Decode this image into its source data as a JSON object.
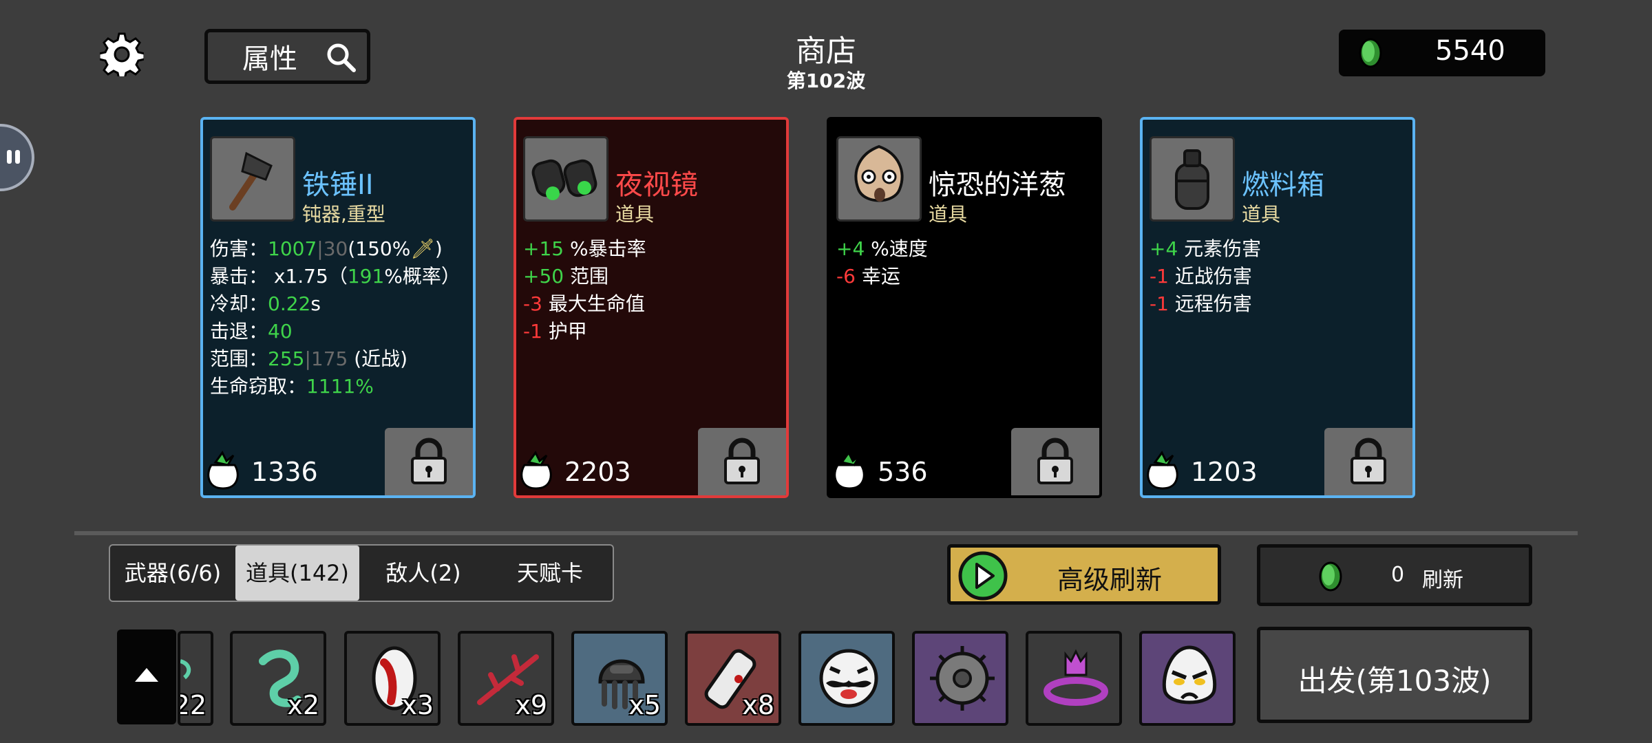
{
  "header": {
    "title": "商店",
    "wave": "第102波",
    "search_label": "属性",
    "money": "5540"
  },
  "cards": [
    {
      "name": "铁锤II",
      "type": "钝器,重型",
      "name_color": "#6cc3ff",
      "icon": "hammer-icon",
      "stats": {
        "damage_label": "伤害：",
        "damage_val": "1007",
        "damage_sep": "|30",
        "damage_pct": "(150%",
        "damage_end": ")",
        "crit_label": "暴击： x1.75（",
        "crit_val": "191",
        "crit_end": "%概率）",
        "cd_label": "冷却：",
        "cd_val": "0.22",
        "cd_unit": "s",
        "kb_label": "击退：",
        "kb_val": "40",
        "range_label": "范围：",
        "range_val": "255",
        "range_sep": "|175",
        "range_end": " (近战)",
        "ls_label": "生命窃取：",
        "ls_val": "1111%"
      },
      "price": "1336"
    },
    {
      "name": "夜视镜",
      "type": "道具",
      "name_color": "#ff4a4a",
      "icon": "binoculars-icon",
      "stats": [
        {
          "val": "+15",
          "text": " %暴击率",
          "color": "g"
        },
        {
          "val": "+50",
          "text": " 范围",
          "color": "g"
        },
        {
          "val": "-3",
          "text": " 最大生命值",
          "color": "r"
        },
        {
          "val": "-1",
          "text": " 护甲",
          "color": "r"
        }
      ],
      "price": "2203"
    },
    {
      "name": "惊恐的洋葱",
      "type": "道具",
      "name_color": "#ffffff",
      "icon": "onion-face-icon",
      "stats": [
        {
          "val": "+4",
          "text": " %速度",
          "color": "g"
        },
        {
          "val": "-6",
          "text": " 幸运",
          "color": "r"
        }
      ],
      "price": "536"
    },
    {
      "name": "燃料箱",
      "type": "道具",
      "name_color": "#6cc3ff",
      "icon": "fuel-tank-icon",
      "stats": [
        {
          "val": "+4",
          "text": " 元素伤害",
          "color": "g"
        },
        {
          "val": "-1",
          "text": " 近战伤害",
          "color": "r"
        },
        {
          "val": "-1",
          "text": " 远程伤害",
          "color": "r"
        }
      ],
      "price": "1203"
    }
  ],
  "tabs": [
    {
      "label": "武器(6/6)"
    },
    {
      "label": "道具(142)",
      "active": true
    },
    {
      "label": "敌人(2)"
    },
    {
      "label": "天赋卡"
    }
  ],
  "advanced_refresh": "高级刷新",
  "refresh": {
    "count": "0",
    "label": "刷新"
  },
  "inventory": [
    {
      "qty": "22",
      "icon": "partial-item-icon",
      "bg": "#3a3a3a"
    },
    {
      "qty": "x2",
      "icon": "ghost-swirl-icon",
      "bg": "#3a3a3a"
    },
    {
      "qty": "x3",
      "icon": "fang-mouth-icon",
      "bg": "#3a3a3a"
    },
    {
      "qty": "x9",
      "icon": "thorn-branch-icon",
      "bg": "#3a3a3a"
    },
    {
      "qty": "x5",
      "icon": "helmet-jellyfish-icon",
      "bg": "#4f6b80"
    },
    {
      "qty": "x8",
      "icon": "scroll-icon",
      "bg": "#7d3f3f"
    },
    {
      "qty": "",
      "icon": "mustache-face-icon",
      "bg": "#4f6b80"
    },
    {
      "qty": "",
      "icon": "spiked-shield-icon",
      "bg": "#5d4578"
    },
    {
      "qty": "",
      "icon": "purple-crown-icon",
      "bg": "#3a3a3a"
    },
    {
      "qty": "",
      "icon": "angry-egg-icon",
      "bg": "#5d4578"
    }
  ],
  "depart": "出发(第103波)"
}
